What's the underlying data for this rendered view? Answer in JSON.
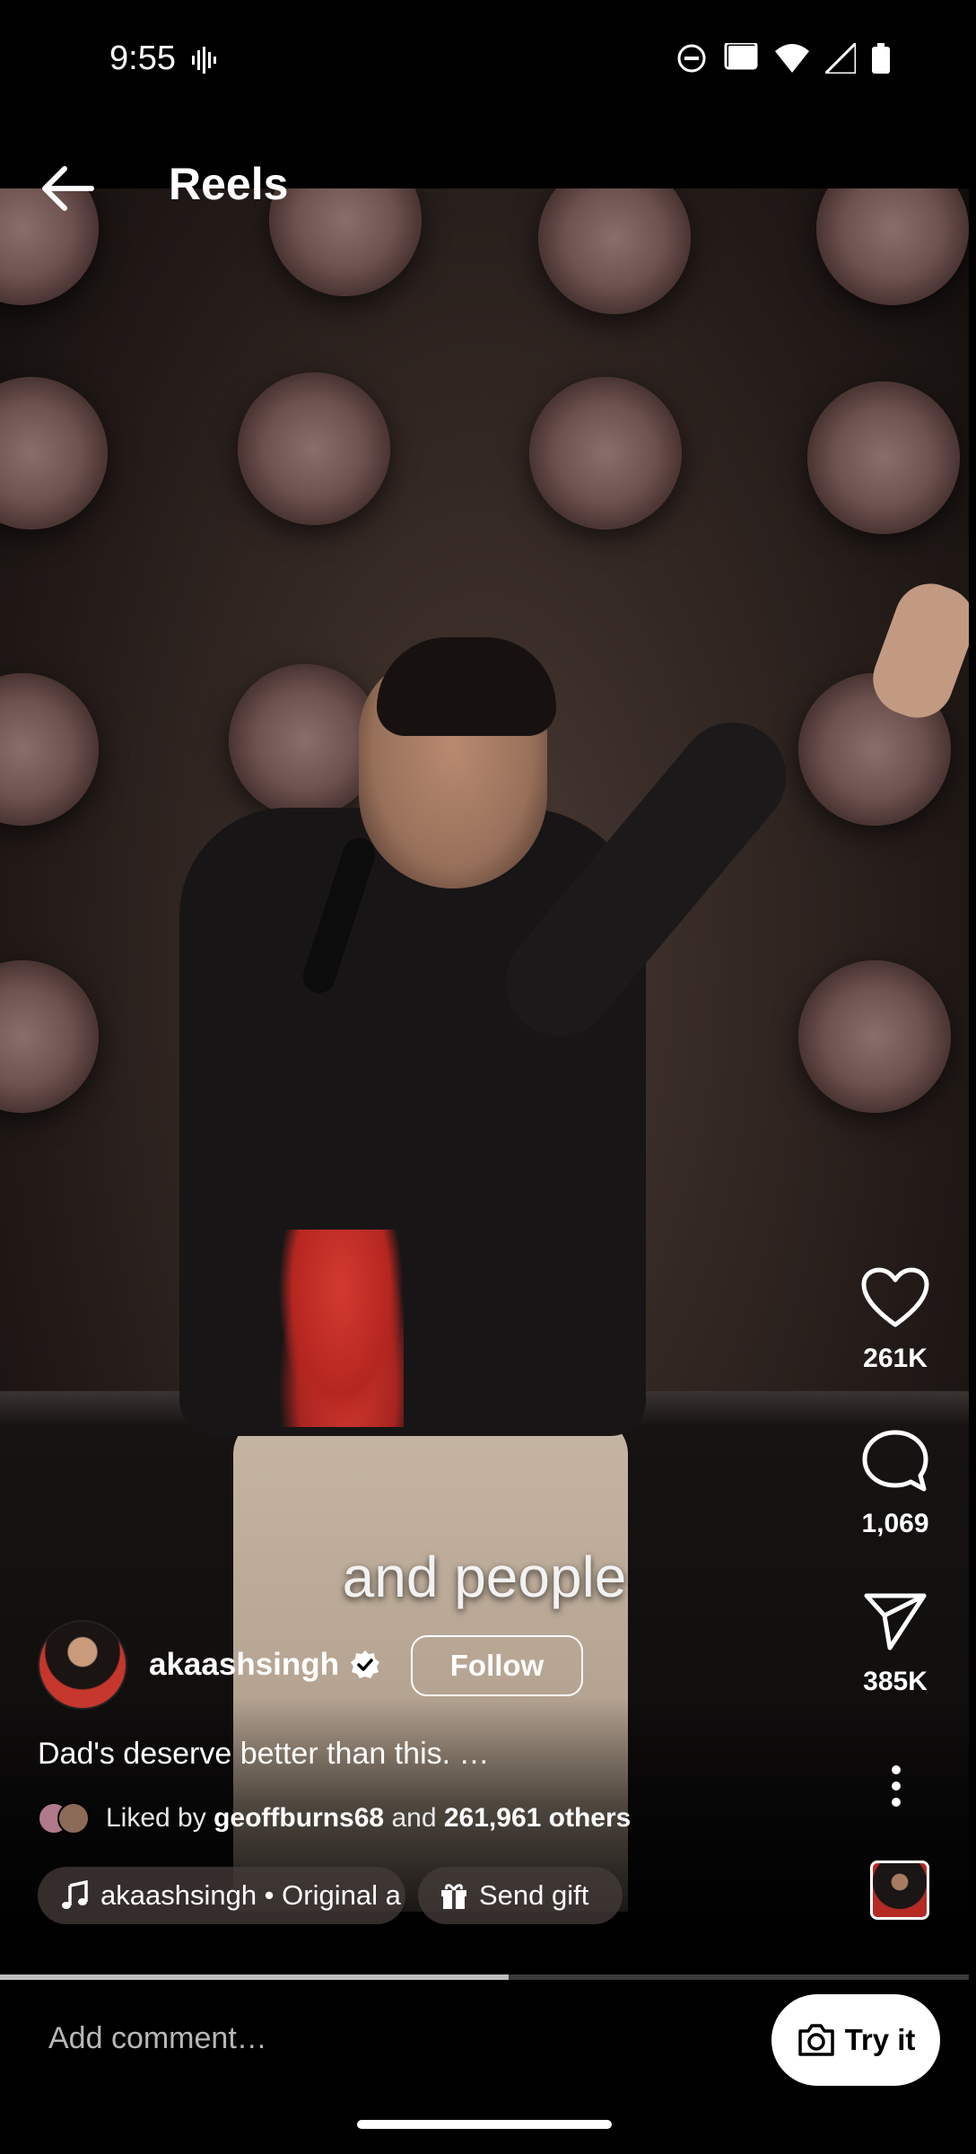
{
  "status_bar": {
    "time": "9:55",
    "icons": [
      "voice-wave-icon",
      "do-not-disturb-icon",
      "cast-icon",
      "wifi-icon",
      "signal-icon",
      "battery-icon"
    ]
  },
  "header": {
    "back_icon": "arrow-left-icon",
    "title": "Reels"
  },
  "video": {
    "caption": "and people",
    "progress_fraction": 0.525
  },
  "actions": {
    "like": {
      "icon": "heart-icon",
      "count": "261K"
    },
    "comment": {
      "icon": "comment-bubble-icon",
      "count": "1,069"
    },
    "share": {
      "icon": "send-icon",
      "count": "385K"
    },
    "more_icon": "more-vertical-icon"
  },
  "author": {
    "username": "akaashsingh",
    "verified_icon": "verified-badge-icon",
    "follow_label": "Follow"
  },
  "post": {
    "description": "Dad's deserve better than this. …",
    "liked_prefix": "Liked by",
    "liked_user": "geoffburns68",
    "liked_and": "and",
    "liked_others": "261,961 others"
  },
  "chips": {
    "audio_label": "akaashsingh • Original a",
    "gift_label": "Send gift"
  },
  "comment_bar": {
    "placeholder": "Add comment…",
    "try_label": "Try it"
  },
  "colors": {
    "background": "#000000",
    "text": "#ffffff",
    "chip_bg": "#463c3a"
  }
}
